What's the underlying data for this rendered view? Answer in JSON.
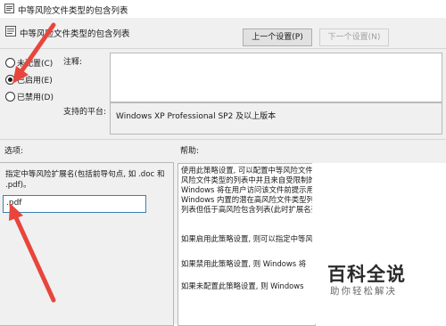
{
  "window": {
    "title": "中等风险文件类型的包含列表"
  },
  "header": {
    "title": "中等风险文件类型的包含列表",
    "prev_button": "上一个设置(P)",
    "next_button": "下一个设置(N)"
  },
  "state": {
    "options": [
      {
        "label": "未配置(C)",
        "selected": false
      },
      {
        "label": "已启用(E)",
        "selected": true
      },
      {
        "label": "已禁用(D)",
        "selected": false
      }
    ]
  },
  "comment": {
    "label": "注释:"
  },
  "platform": {
    "label": "支持的平台:",
    "value": "Windows XP Professional SP2 及以上版本"
  },
  "options_panel": {
    "title": "选项:",
    "description": "指定中等风险扩展名(包括前导句点, 如 .doc 和 .pdf)。",
    "input_value": ".pdf"
  },
  "help_panel": {
    "title": "帮助:",
    "lines": [
      "使用此策略设置, 可以配置中等风险文件类型的列表。如果附件位于中等",
      "风险文件类型的列表中并且来自受限制的区域或 Internet 区域, 则",
      "Windows 将在用户访问该文件前提示用户。此包含列表会替代",
      "Windows 内置的潜在高风险文件类型列表, 它的优先级高于低风险包含",
      "列表但低于高风险包含列表(此时扩展名列在多个包含列表中)。",
      "如果启用此策略设置, 则可以指定中等风险的文件类型。",
      "如果禁用此策略设置, 则 Windows 将",
      "如果未配置此策略设置, 则 Windows"
    ]
  },
  "watermark": {
    "main": "百科全说",
    "sub": "助你轻松解决"
  },
  "colors": {
    "arrow": "#e8453c",
    "accent": "#3c7fb1"
  }
}
